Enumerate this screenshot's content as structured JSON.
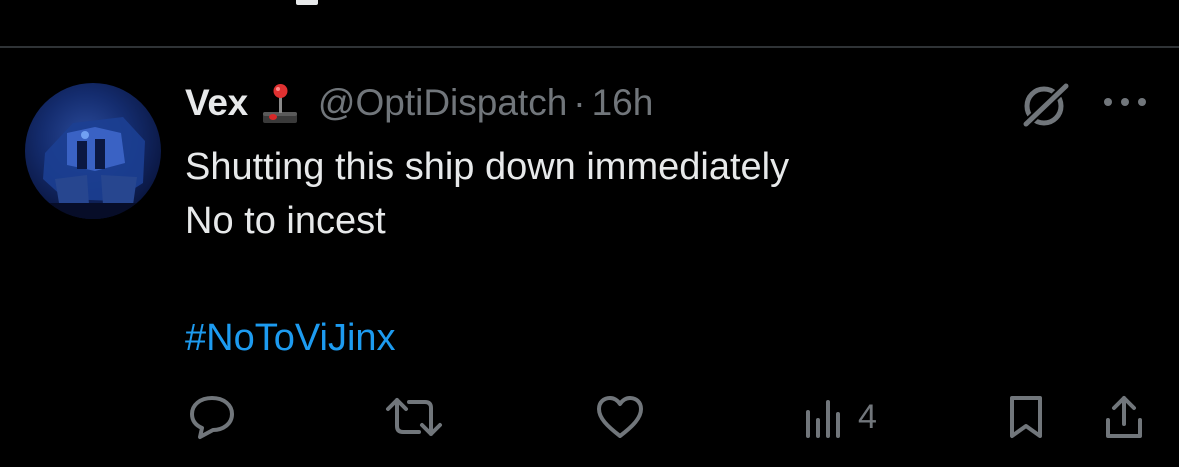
{
  "tweet": {
    "display_name": "Vex",
    "name_emoji": "joystick-emoji",
    "handle": "@OptiDispatch",
    "separator": "·",
    "timestamp": "16h",
    "text": "Shutting this ship down immediately\nNo to incest",
    "hashtag": "#NoToViJinx"
  },
  "actions": {
    "reply": {
      "icon": "reply-icon"
    },
    "retweet": {
      "icon": "retweet-icon"
    },
    "like": {
      "icon": "like-icon"
    },
    "views": {
      "icon": "views-icon",
      "count": "4"
    },
    "bookmark": {
      "icon": "bookmark-icon"
    },
    "share": {
      "icon": "share-icon"
    }
  },
  "colors": {
    "background": "#000000",
    "primary_text": "#e7e9ea",
    "secondary_text": "#71767b",
    "link": "#1d9bf0",
    "divider": "#2f3336"
  }
}
